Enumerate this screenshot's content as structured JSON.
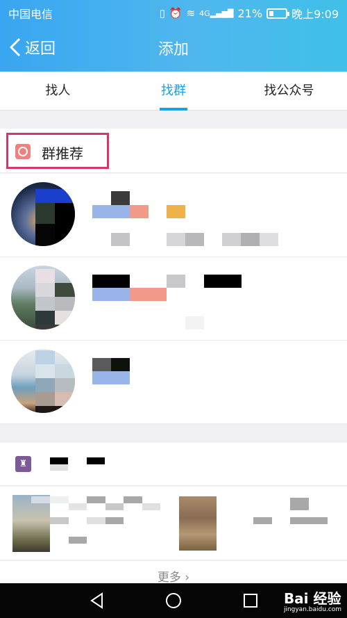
{
  "status_bar": {
    "carrier": "中国电信",
    "battery": "21%",
    "time": "晚上9:09",
    "network": "4G"
  },
  "header": {
    "back_label": "返回",
    "title": "添加"
  },
  "tabs": [
    {
      "label": "找人",
      "active": false
    },
    {
      "label": "找群",
      "active": true
    },
    {
      "label": "找公众号",
      "active": false
    }
  ],
  "group_recommend": {
    "label": "群推荐"
  },
  "more_label": "更多",
  "watermark": {
    "brand": "Bai 经验",
    "url": "jingyan.baidu.com"
  },
  "colors": {
    "accent": "#1aa0e6",
    "highlight": "#d8336c",
    "header_start": "#38a6f0",
    "header_end": "#3fc0e8"
  },
  "icons": [
    "back-chevron-icon",
    "recommend-icon",
    "trophy-icon",
    "triangle-back-icon",
    "circle-home-icon",
    "square-recent-icon"
  ]
}
